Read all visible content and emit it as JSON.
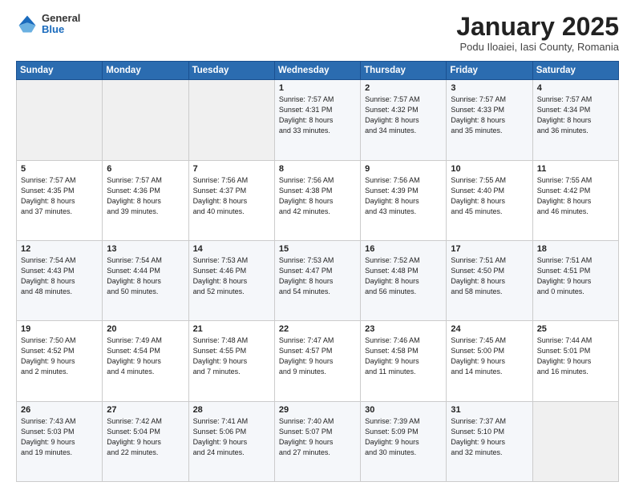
{
  "header": {
    "logo_general": "General",
    "logo_blue": "Blue",
    "month_title": "January 2025",
    "subtitle": "Podu Iloaiei, Iasi County, Romania"
  },
  "days_of_week": [
    "Sunday",
    "Monday",
    "Tuesday",
    "Wednesday",
    "Thursday",
    "Friday",
    "Saturday"
  ],
  "weeks": [
    [
      {
        "day": "",
        "info": ""
      },
      {
        "day": "",
        "info": ""
      },
      {
        "day": "",
        "info": ""
      },
      {
        "day": "1",
        "info": "Sunrise: 7:57 AM\nSunset: 4:31 PM\nDaylight: 8 hours\nand 33 minutes."
      },
      {
        "day": "2",
        "info": "Sunrise: 7:57 AM\nSunset: 4:32 PM\nDaylight: 8 hours\nand 34 minutes."
      },
      {
        "day": "3",
        "info": "Sunrise: 7:57 AM\nSunset: 4:33 PM\nDaylight: 8 hours\nand 35 minutes."
      },
      {
        "day": "4",
        "info": "Sunrise: 7:57 AM\nSunset: 4:34 PM\nDaylight: 8 hours\nand 36 minutes."
      }
    ],
    [
      {
        "day": "5",
        "info": "Sunrise: 7:57 AM\nSunset: 4:35 PM\nDaylight: 8 hours\nand 37 minutes."
      },
      {
        "day": "6",
        "info": "Sunrise: 7:57 AM\nSunset: 4:36 PM\nDaylight: 8 hours\nand 39 minutes."
      },
      {
        "day": "7",
        "info": "Sunrise: 7:56 AM\nSunset: 4:37 PM\nDaylight: 8 hours\nand 40 minutes."
      },
      {
        "day": "8",
        "info": "Sunrise: 7:56 AM\nSunset: 4:38 PM\nDaylight: 8 hours\nand 42 minutes."
      },
      {
        "day": "9",
        "info": "Sunrise: 7:56 AM\nSunset: 4:39 PM\nDaylight: 8 hours\nand 43 minutes."
      },
      {
        "day": "10",
        "info": "Sunrise: 7:55 AM\nSunset: 4:40 PM\nDaylight: 8 hours\nand 45 minutes."
      },
      {
        "day": "11",
        "info": "Sunrise: 7:55 AM\nSunset: 4:42 PM\nDaylight: 8 hours\nand 46 minutes."
      }
    ],
    [
      {
        "day": "12",
        "info": "Sunrise: 7:54 AM\nSunset: 4:43 PM\nDaylight: 8 hours\nand 48 minutes."
      },
      {
        "day": "13",
        "info": "Sunrise: 7:54 AM\nSunset: 4:44 PM\nDaylight: 8 hours\nand 50 minutes."
      },
      {
        "day": "14",
        "info": "Sunrise: 7:53 AM\nSunset: 4:46 PM\nDaylight: 8 hours\nand 52 minutes."
      },
      {
        "day": "15",
        "info": "Sunrise: 7:53 AM\nSunset: 4:47 PM\nDaylight: 8 hours\nand 54 minutes."
      },
      {
        "day": "16",
        "info": "Sunrise: 7:52 AM\nSunset: 4:48 PM\nDaylight: 8 hours\nand 56 minutes."
      },
      {
        "day": "17",
        "info": "Sunrise: 7:51 AM\nSunset: 4:50 PM\nDaylight: 8 hours\nand 58 minutes."
      },
      {
        "day": "18",
        "info": "Sunrise: 7:51 AM\nSunset: 4:51 PM\nDaylight: 9 hours\nand 0 minutes."
      }
    ],
    [
      {
        "day": "19",
        "info": "Sunrise: 7:50 AM\nSunset: 4:52 PM\nDaylight: 9 hours\nand 2 minutes."
      },
      {
        "day": "20",
        "info": "Sunrise: 7:49 AM\nSunset: 4:54 PM\nDaylight: 9 hours\nand 4 minutes."
      },
      {
        "day": "21",
        "info": "Sunrise: 7:48 AM\nSunset: 4:55 PM\nDaylight: 9 hours\nand 7 minutes."
      },
      {
        "day": "22",
        "info": "Sunrise: 7:47 AM\nSunset: 4:57 PM\nDaylight: 9 hours\nand 9 minutes."
      },
      {
        "day": "23",
        "info": "Sunrise: 7:46 AM\nSunset: 4:58 PM\nDaylight: 9 hours\nand 11 minutes."
      },
      {
        "day": "24",
        "info": "Sunrise: 7:45 AM\nSunset: 5:00 PM\nDaylight: 9 hours\nand 14 minutes."
      },
      {
        "day": "25",
        "info": "Sunrise: 7:44 AM\nSunset: 5:01 PM\nDaylight: 9 hours\nand 16 minutes."
      }
    ],
    [
      {
        "day": "26",
        "info": "Sunrise: 7:43 AM\nSunset: 5:03 PM\nDaylight: 9 hours\nand 19 minutes."
      },
      {
        "day": "27",
        "info": "Sunrise: 7:42 AM\nSunset: 5:04 PM\nDaylight: 9 hours\nand 22 minutes."
      },
      {
        "day": "28",
        "info": "Sunrise: 7:41 AM\nSunset: 5:06 PM\nDaylight: 9 hours\nand 24 minutes."
      },
      {
        "day": "29",
        "info": "Sunrise: 7:40 AM\nSunset: 5:07 PM\nDaylight: 9 hours\nand 27 minutes."
      },
      {
        "day": "30",
        "info": "Sunrise: 7:39 AM\nSunset: 5:09 PM\nDaylight: 9 hours\nand 30 minutes."
      },
      {
        "day": "31",
        "info": "Sunrise: 7:37 AM\nSunset: 5:10 PM\nDaylight: 9 hours\nand 32 minutes."
      },
      {
        "day": "",
        "info": ""
      }
    ]
  ]
}
